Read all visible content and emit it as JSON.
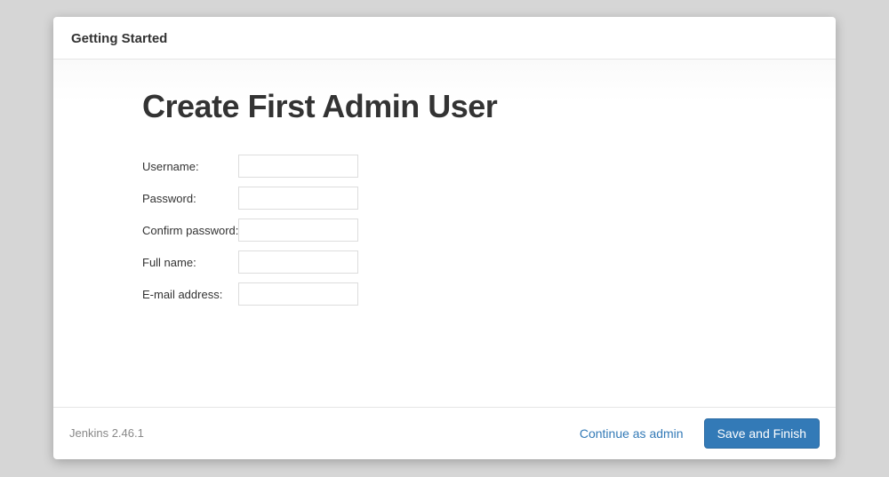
{
  "header": {
    "title": "Getting Started"
  },
  "main": {
    "heading": "Create First Admin User",
    "fields": {
      "username": {
        "label": "Username:",
        "value": ""
      },
      "password": {
        "label": "Password:",
        "value": ""
      },
      "confirm": {
        "label": "Confirm password:",
        "value": ""
      },
      "fullname": {
        "label": "Full name:",
        "value": ""
      },
      "email": {
        "label": "E-mail address:",
        "value": ""
      }
    }
  },
  "footer": {
    "version": "Jenkins 2.46.1",
    "continue_label": "Continue as admin",
    "save_label": "Save and Finish"
  }
}
